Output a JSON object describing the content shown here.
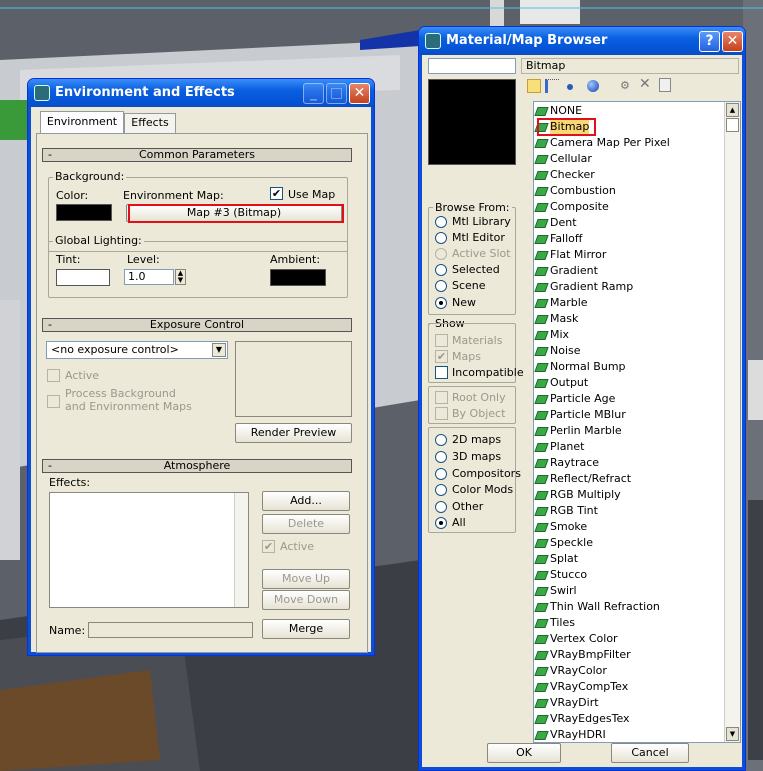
{
  "env": {
    "title": "Environment and Effects",
    "tabs": [
      "Environment",
      "Effects"
    ],
    "common": {
      "header": "Common Parameters",
      "background_label": "Background:",
      "color_label": "Color:",
      "env_map_label": "Environment Map:",
      "use_map_label": "Use Map",
      "map_button": "Map #3 (Bitmap)",
      "global_lighting_label": "Global Lighting:",
      "tint_label": "Tint:",
      "level_label": "Level:",
      "level_value": "1.0",
      "ambient_label": "Ambient:"
    },
    "exposure": {
      "header": "Exposure Control",
      "dropdown_value": "<no exposure control>",
      "active_label": "Active",
      "process_bg_label_1": "Process Background",
      "process_bg_label_2": "and Environment Maps",
      "render_preview": "Render Preview"
    },
    "atmosphere": {
      "header": "Atmosphere",
      "effects_label": "Effects:",
      "add": "Add...",
      "delete": "Delete",
      "active_label": "Active",
      "move_up": "Move Up",
      "move_down": "Move Down",
      "name_label": "Name:",
      "merge": "Merge"
    }
  },
  "browser": {
    "title": "Material/Map Browser",
    "name_value": "Bitmap",
    "browse_from": {
      "label": "Browse From:",
      "options": [
        "Mtl Library",
        "Mtl Editor",
        "Active Slot",
        "Selected",
        "Scene",
        "New"
      ]
    },
    "show": {
      "label": "Show",
      "options": [
        "Materials",
        "Maps",
        "Incompatible"
      ]
    },
    "root_only": "Root Only",
    "by_object": "By Object",
    "map_types": [
      "2D maps",
      "3D maps",
      "Compositors",
      "Color Mods",
      "Other",
      "All"
    ],
    "items": [
      "NONE",
      "Bitmap",
      "Camera Map Per Pixel",
      "Cellular",
      "Checker",
      "Combustion",
      "Composite",
      "Dent",
      "Falloff",
      "Flat Mirror",
      "Gradient",
      "Gradient Ramp",
      "Marble",
      "Mask",
      "Mix",
      "Noise",
      "Normal Bump",
      "Output",
      "Particle Age",
      "Particle MBlur",
      "Perlin Marble",
      "Planet",
      "Raytrace",
      "Reflect/Refract",
      "RGB Multiply",
      "RGB Tint",
      "Smoke",
      "Speckle",
      "Splat",
      "Stucco",
      "Swirl",
      "Thin Wall Refraction",
      "Tiles",
      "Vertex Color",
      "VRayBmpFilter",
      "VRayColor",
      "VRayCompTex",
      "VRayDirt",
      "VRayEdgesTex",
      "VRayHDRI"
    ],
    "ok": "OK",
    "cancel": "Cancel"
  }
}
